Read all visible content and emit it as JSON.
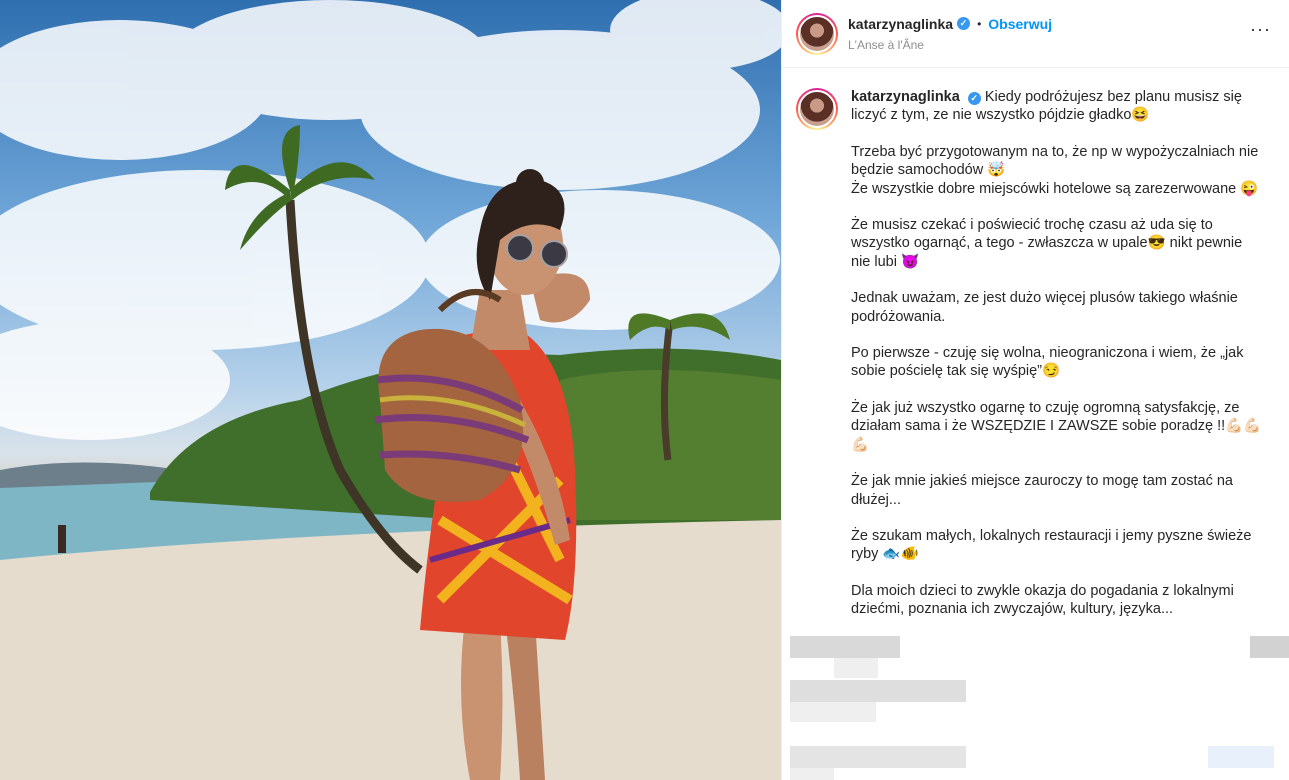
{
  "post": {
    "username": "katarzynaglinka",
    "verified_mark": "✓",
    "separator": "•",
    "follow_label": "Obserwuj",
    "location": "L'Anse à l'Âne",
    "more_label": "···"
  },
  "caption": {
    "username": "katarzynaglinka",
    "paragraphs": [
      [
        "Kiedy podróżujesz bez planu musisz się",
        "liczyć z tym, ze nie wszystko pójdzie gładko😆"
      ],
      [
        "Trzeba być przygotowanym na to, że np w wypożyczalniach nie",
        "będzie samochodów 🤯",
        "Że wszystkie dobre miejscówki hotelowe są zarezerwowane 😜"
      ],
      [
        "Że musisz czekać i poświecić trochę czasu aż uda się to",
        "wszystko ogarnąć, a tego - zwłaszcza w upale😎 nikt pewnie",
        "nie lubi 😈"
      ],
      [
        "Jednak uważam, ze jest dużo więcej plusów takiego właśnie",
        "podróżowania."
      ],
      [
        "Po pierwsze - czuję się wolna, nieograniczona i wiem, że „jak",
        "sobie pościelę tak się wyśpię”😏"
      ],
      [
        "Że jak już wszystko ogarnę to czuję ogromną satysfakcję, ze",
        "działam sama i że WSZĘDZIE I ZAWSZE sobie poradzę !!💪🏻💪🏻",
        "💪🏻"
      ],
      [
        "Że jak mnie jakieś miejsce zauroczy to mogę tam zostać na",
        "dłużej..."
      ],
      [
        "Że szukam małych, lokalnych restauracji i jemy pyszne świeże",
        "ryby 🐟🐠"
      ],
      [
        "Dla moich dzieci to zwykle okazja do pogadania z lokalnymi",
        "dziećmi, poznania ich zwyczajów, kultury, języka..."
      ]
    ]
  },
  "colors": {
    "accent": "#0095f6",
    "verified": "#3897f0",
    "text": "#262626",
    "muted": "#8e8e8e"
  }
}
